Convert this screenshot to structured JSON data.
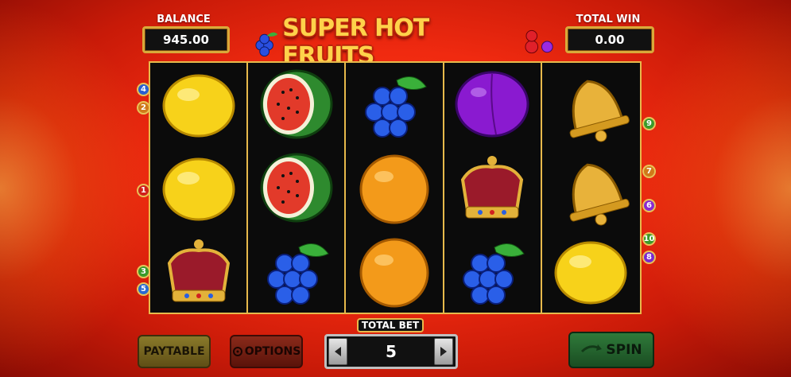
{
  "header": {
    "balance_label": "BALANCE",
    "balance_value": "945.00",
    "total_win_label": "TOTAL WIN",
    "total_win_value": "0.00",
    "logo_text": "SUPER HOT FRUITS"
  },
  "reels": [
    [
      "lemon",
      "lemon",
      "crown"
    ],
    [
      "watermelon",
      "watermelon",
      "grapes"
    ],
    [
      "grapes",
      "orange",
      "orange"
    ],
    [
      "plum",
      "crown",
      "grapes"
    ],
    [
      "bell",
      "bell",
      "lemon"
    ]
  ],
  "paylines_left": [
    {
      "num": "4",
      "color": "#2a5fd0"
    },
    {
      "num": "2",
      "color": "#d07a1a"
    },
    {
      "num": "1",
      "color": "#d0201a"
    },
    {
      "num": "3",
      "color": "#3a9a2a"
    },
    {
      "num": "5",
      "color": "#2a6ad0"
    }
  ],
  "paylines_right": [
    {
      "num": "9",
      "color": "#3a9a2a"
    },
    {
      "num": "7",
      "color": "#d07a1a"
    },
    {
      "num": "6",
      "color": "#8a2ad0"
    },
    {
      "num": "10",
      "color": "#3a9a2a"
    },
    {
      "num": "8",
      "color": "#7a2ad0"
    }
  ],
  "controls": {
    "paytable_label": "PAYTABLE",
    "options_label": "OPTIONS",
    "total_bet_label": "TOTAL BET",
    "total_bet_value": "5",
    "spin_label": "SPIN"
  }
}
